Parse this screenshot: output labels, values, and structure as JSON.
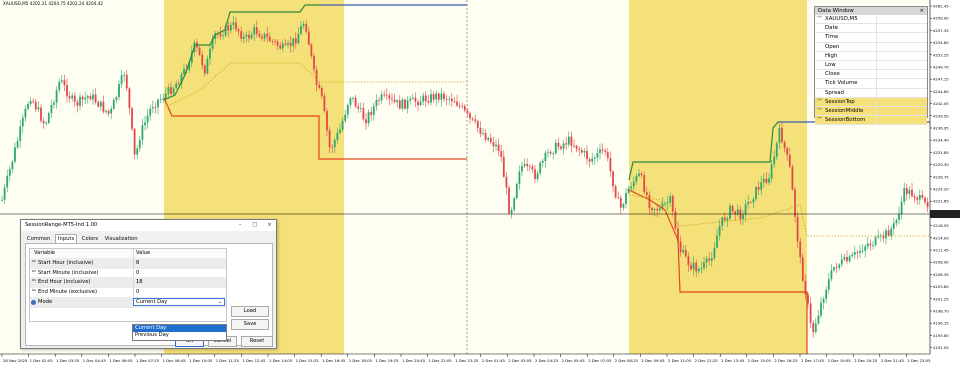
{
  "chart": {
    "symbol_header": "XAUUSD,M5  4202.31  4204.75  4202.24  4204.42",
    "colors": {
      "bg": "#fffef2",
      "session_fill": "#f5e17a",
      "candle_up": "#2ea86e",
      "candle_down": "#e2474b",
      "session_top": "#2d8a3a",
      "session_bottom": "#e2471e",
      "session_middle": "#c9a81a",
      "crosshair": "#000000"
    },
    "price_labels": [
      "4262.45",
      "4259.90",
      "4257.35",
      "4254.80",
      "4252.25",
      "4249.70",
      "4247.15",
      "4244.60",
      "4242.05",
      "4239.50",
      "4236.95",
      "4234.40",
      "4231.85",
      "4229.30",
      "4226.75",
      "4224.20",
      "4221.65",
      "4219.10",
      "4216.55",
      "4214.00",
      "4211.45",
      "4208.90",
      "4206.35",
      "4203.80",
      "4201.25",
      "4198.70",
      "4196.15",
      "4193.60",
      "4191.05"
    ],
    "time_labels": [
      "28 Nov 2025",
      "1 Dec 02:05",
      "1 Dec 03:25",
      "1 Dec 04:45",
      "1 Dec 06:05",
      "1 Dec 07:25",
      "1 Dec 08:45",
      "1 Dec 10:05",
      "1 Dec 11:25",
      "1 Dec 12:45",
      "1 Dec 14:05",
      "1 Dec 15:25",
      "1 Dec 16:45",
      "1 Dec 18:05",
      "1 Dec 19:25",
      "1 Dec 20:45",
      "1 Dec 22:05",
      "1 Dec 23:25",
      "2 Dec 01:45",
      "2 Dec 03:05",
      "2 Dec 04:25",
      "2 Dec 05:45",
      "2 Dec 07:05",
      "2 Dec 08:25",
      "2 Dec 09:45",
      "2 Dec 11:05",
      "2 Dec 12:25",
      "2 Dec 13:45",
      "2 Dec 15:05",
      "2 Dec 16:25",
      "2 Dec 17:45",
      "2 Dec 19:05",
      "2 Dec 20:25",
      "2 Dec 21:45",
      "2 Dec 23:05"
    ]
  },
  "data_window": {
    "title": "Data Window",
    "close_glyph": "×",
    "rows": [
      {
        "label": "XAUUSD,M5",
        "icon": "⺍",
        "session": false
      },
      {
        "label": "Date",
        "icon": "",
        "session": false
      },
      {
        "label": "Time",
        "icon": "",
        "session": false
      },
      {
        "label": "Open",
        "icon": "",
        "session": false
      },
      {
        "label": "High",
        "icon": "",
        "session": false
      },
      {
        "label": "Low",
        "icon": "",
        "session": false
      },
      {
        "label": "Close",
        "icon": "",
        "session": false
      },
      {
        "label": "Tick Volume",
        "icon": "",
        "session": false
      },
      {
        "label": "Spread",
        "icon": "",
        "session": false
      },
      {
        "label": "SessionTop",
        "icon": "⺍",
        "session": true
      },
      {
        "label": "SessionMiddle",
        "icon": "⺍",
        "session": true
      },
      {
        "label": "SessionBottom",
        "icon": "⺍",
        "session": true
      }
    ]
  },
  "dialog": {
    "title": "SessionRange-MT5-Ind 1.00",
    "controls": {
      "min": "–",
      "max": "□",
      "close": "×"
    },
    "tabs": [
      "Common",
      "Inputs",
      "Colors",
      "Visualization"
    ],
    "active_tab": "Inputs",
    "columns": {
      "variable": "Variable",
      "value": "Value"
    },
    "params": [
      {
        "name": "Start Hour (inclusive)",
        "value": "8"
      },
      {
        "name": "Start Minute (inclusive)",
        "value": "0"
      },
      {
        "name": "End Hour (inclusive)",
        "value": "18"
      },
      {
        "name": "End Minute (exclusive)",
        "value": "0"
      }
    ],
    "mode": {
      "name": "Mode",
      "value": "Current Day",
      "options": [
        "Current Day",
        "Previous Day"
      ]
    },
    "buttons": {
      "load": "Load",
      "save": "Save",
      "ok": "OK",
      "cancel": "Cancel",
      "reset": "Reset"
    }
  }
}
